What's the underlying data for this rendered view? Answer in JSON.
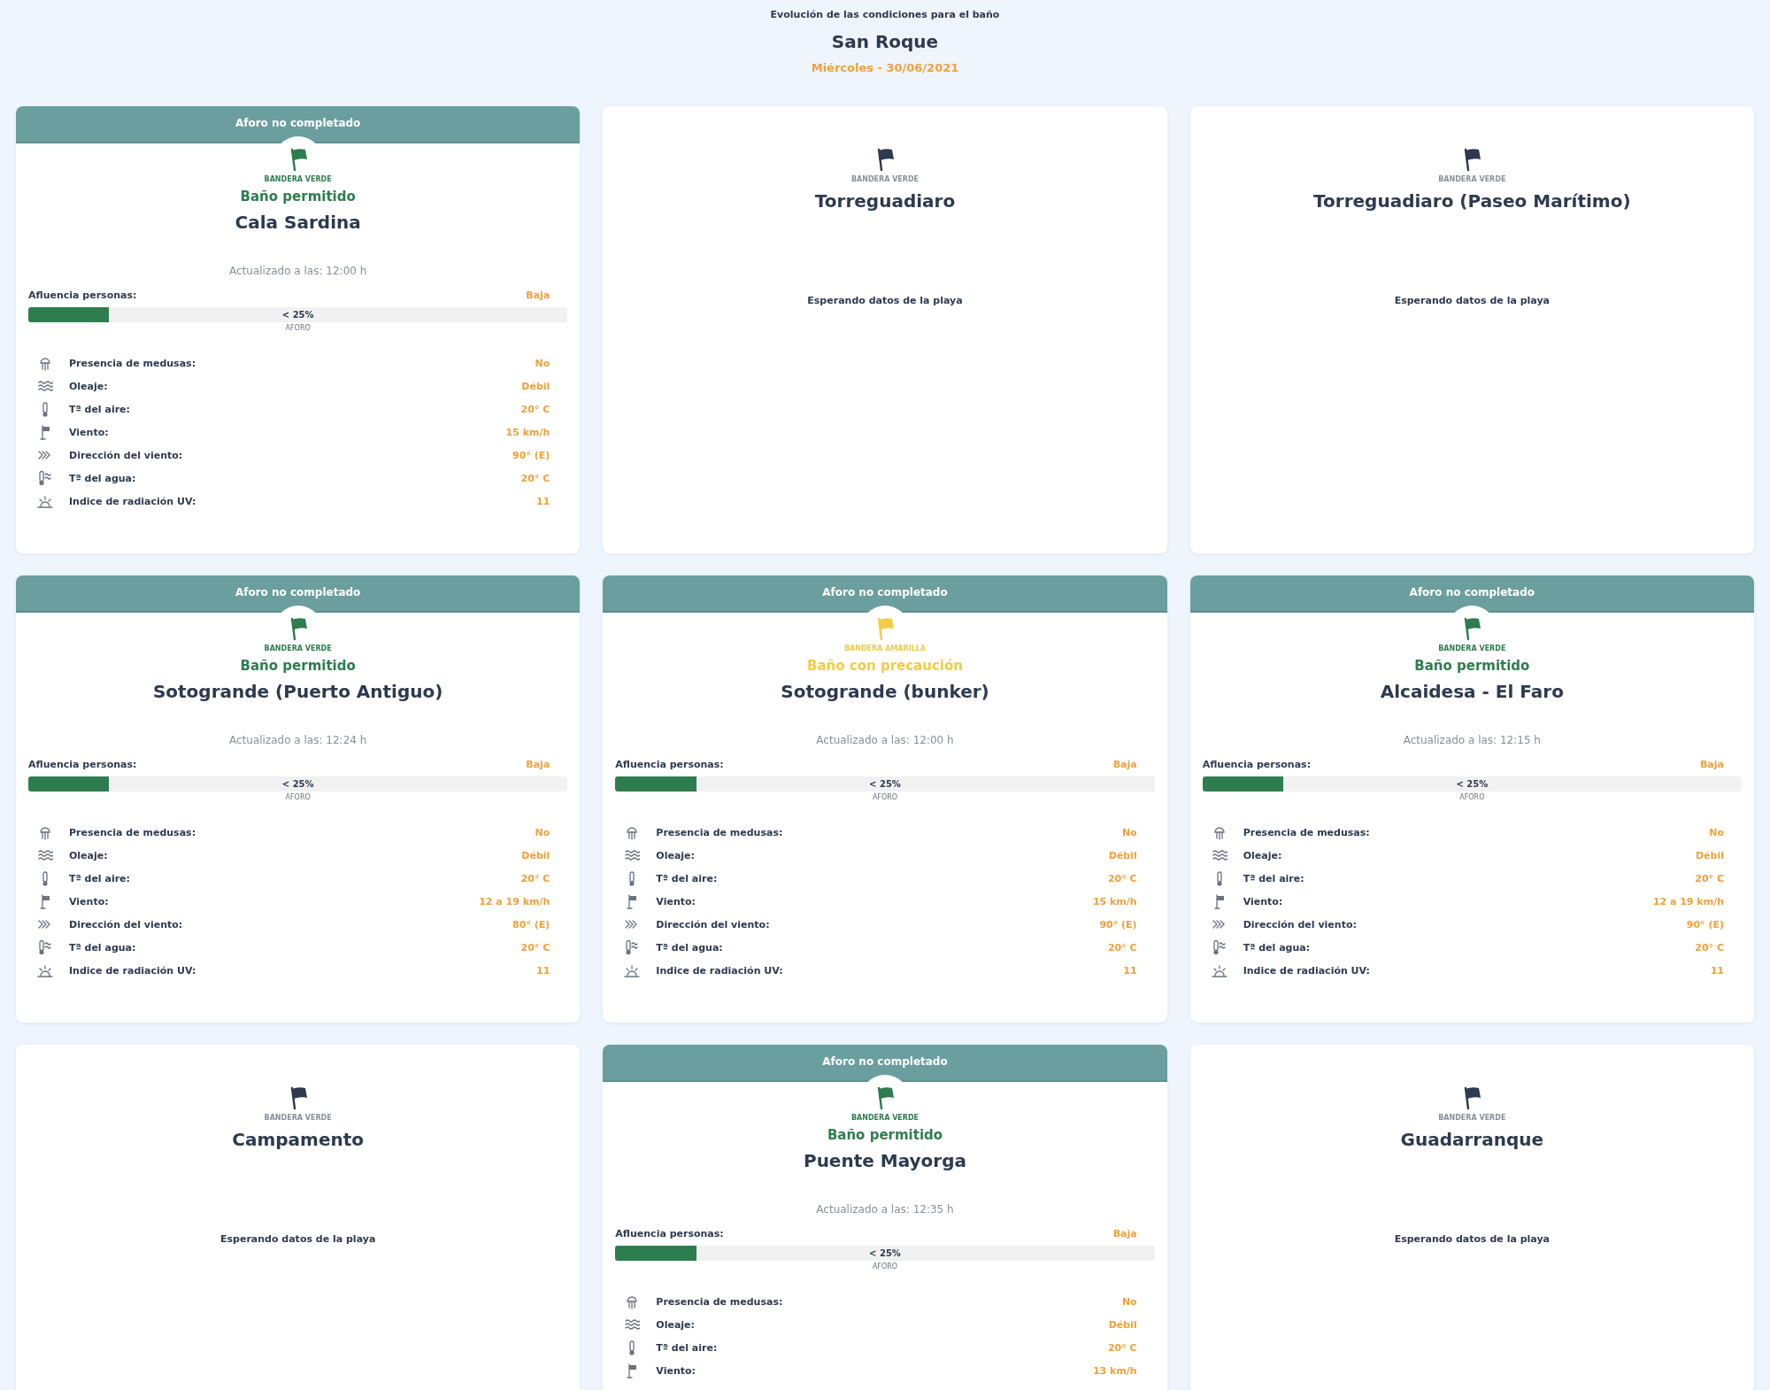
{
  "header": {
    "subtitle": "Evolución de las condiciones para el baño",
    "title": "San Roque",
    "date": "Miércoles - 30/06/2021"
  },
  "beaches": [
    {
      "kind": "data",
      "banner": "Aforo no completado",
      "flag": {
        "label": "BANDERA VERDE",
        "color": "#2e7d4f"
      },
      "bathing": "Baño permitido",
      "name": "Cala Sardina",
      "updated": "Actualizado a las: 12:00 h",
      "crowd": {
        "label": "Afluencia personas:",
        "value": "Baja",
        "level": 0.15,
        "reading": "< 25%",
        "caption": "AFORO"
      },
      "rows": [
        {
          "kind": "jellyfish",
          "label": "Presencia de medusas:",
          "value": "No"
        },
        {
          "kind": "waves",
          "label": "Oleaje:",
          "value": "Débil"
        },
        {
          "kind": "thermometer",
          "label": "Tª del aire:",
          "value": "20° C"
        },
        {
          "kind": "windsock",
          "label": "Viento:",
          "value": "15 km/h"
        },
        {
          "kind": "chevrons",
          "label": "Dirección del viento:",
          "value": "90° (E)"
        },
        {
          "kind": "water-thermometer",
          "label": "Tª del agua:",
          "value": "20° C"
        },
        {
          "kind": "sun",
          "label": "Indice de radiación UV:",
          "value": "11"
        }
      ]
    },
    {
      "kind": "waiting",
      "flag": {
        "label": "BANDERA VERDE",
        "color": "#2d3a4f"
      },
      "name": "Torreguadiaro",
      "message": "Esperando datos de la playa"
    },
    {
      "kind": "waiting",
      "flag": {
        "label": "BANDERA VERDE",
        "color": "#2d3a4f"
      },
      "name": "Torreguadiaro (Paseo Marítimo)",
      "message": "Esperando datos de la playa"
    },
    {
      "kind": "data",
      "banner": "Aforo no completado",
      "flag": {
        "label": "BANDERA VERDE",
        "color": "#2e7d4f"
      },
      "bathing": "Baño permitido",
      "name": "Sotogrande (Puerto Antiguo)",
      "updated": "Actualizado a las: 12:24 h",
      "crowd": {
        "label": "Afluencia personas:",
        "value": "Baja",
        "level": 0.15,
        "reading": "< 25%",
        "caption": "AFORO"
      },
      "rows": [
        {
          "kind": "jellyfish",
          "label": "Presencia de medusas:",
          "value": "No"
        },
        {
          "kind": "waves",
          "label": "Oleaje:",
          "value": "Débil"
        },
        {
          "kind": "thermometer",
          "label": "Tª del aire:",
          "value": "20° C"
        },
        {
          "kind": "windsock",
          "label": "Viento:",
          "value": "12 a 19 km/h"
        },
        {
          "kind": "chevrons",
          "label": "Dirección del viento:",
          "value": "80° (E)"
        },
        {
          "kind": "water-thermometer",
          "label": "Tª del agua:",
          "value": "20° C"
        },
        {
          "kind": "sun",
          "label": "Indice de radiación UV:",
          "value": "11"
        }
      ]
    },
    {
      "kind": "data",
      "banner": "Aforo no completado",
      "flag": {
        "label": "BANDERA AMARILLA",
        "color": "#f2cc45"
      },
      "bathing": "Baño con precaución",
      "name": "Sotogrande (bunker)",
      "updated": "Actualizado a las: 12:00 h",
      "crowd": {
        "label": "Afluencia personas:",
        "value": "Baja",
        "level": 0.15,
        "reading": "< 25%",
        "caption": "AFORO"
      },
      "rows": [
        {
          "kind": "jellyfish",
          "label": "Presencia de medusas:",
          "value": "No"
        },
        {
          "kind": "waves",
          "label": "Oleaje:",
          "value": "Débil"
        },
        {
          "kind": "thermometer",
          "label": "Tª del aire:",
          "value": "20° C"
        },
        {
          "kind": "windsock",
          "label": "Viento:",
          "value": "15 km/h"
        },
        {
          "kind": "chevrons",
          "label": "Dirección del viento:",
          "value": "90° (E)"
        },
        {
          "kind": "water-thermometer",
          "label": "Tª del agua:",
          "value": "20° C"
        },
        {
          "kind": "sun",
          "label": "Indice de radiación UV:",
          "value": "11"
        }
      ]
    },
    {
      "kind": "data",
      "banner": "Aforo no completado",
      "flag": {
        "label": "BANDERA VERDE",
        "color": "#2e7d4f"
      },
      "bathing": "Baño permitido",
      "name": "Alcaidesa - El Faro",
      "updated": "Actualizado a las: 12:15 h",
      "crowd": {
        "label": "Afluencia personas:",
        "value": "Baja",
        "level": 0.15,
        "reading": "< 25%",
        "caption": "AFORO"
      },
      "rows": [
        {
          "kind": "jellyfish",
          "label": "Presencia de medusas:",
          "value": "No"
        },
        {
          "kind": "waves",
          "label": "Oleaje:",
          "value": "Débil"
        },
        {
          "kind": "thermometer",
          "label": "Tª del aire:",
          "value": "20° C"
        },
        {
          "kind": "windsock",
          "label": "Viento:",
          "value": "12 a 19 km/h"
        },
        {
          "kind": "chevrons",
          "label": "Dirección del viento:",
          "value": "90° (E)"
        },
        {
          "kind": "water-thermometer",
          "label": "Tª del agua:",
          "value": "20° C"
        },
        {
          "kind": "sun",
          "label": "Indice de radiación UV:",
          "value": "11"
        }
      ]
    },
    {
      "kind": "waiting",
      "flag": {
        "label": "BANDERA VERDE",
        "color": "#2d3a4f"
      },
      "name": "Campamento",
      "message": "Esperando datos de la playa"
    },
    {
      "kind": "data",
      "banner": "Aforo no completado",
      "flag": {
        "label": "BANDERA VERDE",
        "color": "#2e7d4f"
      },
      "bathing": "Baño permitido",
      "name": "Puente Mayorga",
      "updated": "Actualizado a las: 12:35 h",
      "crowd": {
        "label": "Afluencia personas:",
        "value": "Baja",
        "level": 0.15,
        "reading": "< 25%",
        "caption": "AFORO"
      },
      "rows": [
        {
          "kind": "jellyfish",
          "label": "Presencia de medusas:",
          "value": "No"
        },
        {
          "kind": "waves",
          "label": "Oleaje:",
          "value": "Débil"
        },
        {
          "kind": "thermometer",
          "label": "Tª del aire:",
          "value": "20° C"
        },
        {
          "kind": "windsock",
          "label": "Viento:",
          "value": "13 km/h"
        }
      ]
    },
    {
      "kind": "waiting",
      "flag": {
        "label": "BANDERA VERDE",
        "color": "#2d3a4f"
      },
      "name": "Guadarranque",
      "message": "Esperando datos de la playa"
    }
  ]
}
